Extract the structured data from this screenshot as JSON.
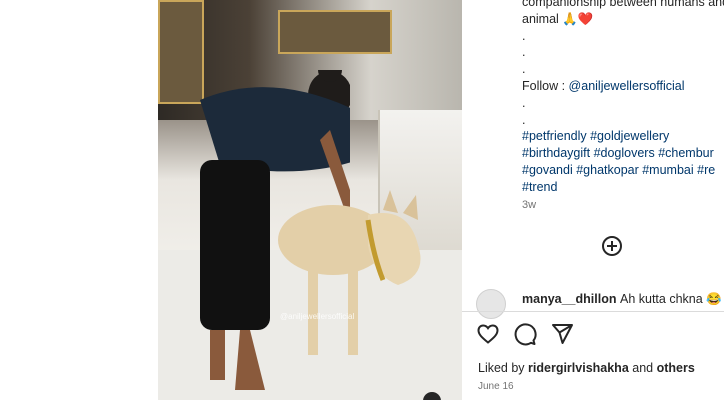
{
  "caption": {
    "line1": "companionship between humans and",
    "line2": "animal",
    "line2_emoji_hands": "🙏",
    "line2_emoji_heart": "❤️",
    "dots": [
      ".",
      ".",
      "."
    ],
    "follow_prefix": "Follow : ",
    "follow_handle": "@aniljewellersofficial",
    "dots2": [
      ".",
      "."
    ],
    "hashtags_line1": "#petfriendly #goldjewellery",
    "hashtags_line2": "#birthdaygift #doglovers #chembur",
    "hashtags_line3": "#govandi #ghatkopar #mumbai #re",
    "hashtags_line4": "#trend"
  },
  "time_ago": "3w",
  "comment": {
    "username": "manya__dhillon",
    "text": "Ah kutta chkna 😂"
  },
  "likes": {
    "prefix": "Liked by ",
    "user": "ridergirlvishakha",
    "middle": " and ",
    "others": "others"
  },
  "post_date": "June 16",
  "media": {
    "watermark": "@aniljewellersofficial"
  },
  "icons": [
    "heart-icon",
    "comment-icon",
    "share-icon",
    "add-comment-icon"
  ],
  "colors": {
    "link": "#00376b",
    "text": "#262626",
    "muted": "#737373",
    "heart": "#ed4956"
  }
}
